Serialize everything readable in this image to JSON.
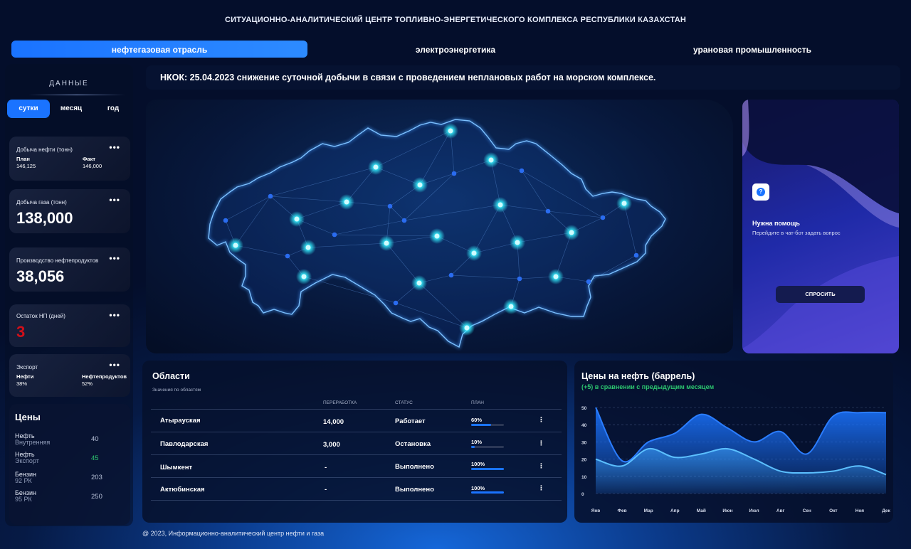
{
  "header": {
    "title": "СИТУАЦИОННО-АНАЛИТИЧЕСКИЙ ЦЕНТР ТОПЛИВНО-ЭНЕРГЕТИЧЕСКОГО КОМПЛЕКСА РЕСПУБЛИКИ КАЗАХСТАН"
  },
  "tabs": [
    {
      "label": "нефтегазовая отрасль",
      "active": true
    },
    {
      "label": "электроэнергетика",
      "active": false
    },
    {
      "label": "урановая промышленность",
      "active": false
    }
  ],
  "sidebar": {
    "heading": "ДАННЫЕ",
    "periods": [
      {
        "label": "сутки",
        "active": true
      },
      {
        "label": "месяц",
        "active": false
      },
      {
        "label": "год",
        "active": false
      }
    ],
    "cards": {
      "oil": {
        "label": "Добыча нефти (тонн)",
        "plan_label": "План",
        "plan_value": "146,125",
        "fact_label": "Факт",
        "fact_value": "146,000"
      },
      "gas": {
        "label": "Добыча газа (тонн)",
        "value": "138,000"
      },
      "products": {
        "label": "Производство нефтепродуктов",
        "value": "38,056"
      },
      "stock": {
        "label": "Остаток НП (дней)",
        "value": "3",
        "color": "#d0101a"
      },
      "export": {
        "label": "Экспорт",
        "oil_label": "Нефти",
        "oil_value": "38%",
        "prod_label": "Нефтепродуктов",
        "prod_value": "52%"
      }
    },
    "prices": {
      "heading": "Цены",
      "items": [
        {
          "name": "Нефть",
          "sub": "Внутренняя",
          "value": "40"
        },
        {
          "name": "Нефть",
          "sub": "Экспорт",
          "value": "45",
          "color": "#2cc56f"
        },
        {
          "name": "Бензин",
          "sub": "92 РК",
          "value": "203"
        },
        {
          "name": "Бензин",
          "sub": "95 РК",
          "value": "250"
        }
      ]
    }
  },
  "news": "НКОК: 25.04.2023 снижение суточной добычи в связи с проведением неплановых работ на морском комплексе.",
  "help": {
    "title": "Нужна помощь",
    "subtitle": "Перейдите в чат-бот задать вопрос",
    "button": "СПРОСИТЬ",
    "icon": "question-icon"
  },
  "regions": {
    "title": "Области",
    "subtitle": "Значения по областям",
    "columns": [
      "ПЕРЕРАБОТКА",
      "СТАТУС",
      "ПЛАН"
    ],
    "rows": [
      {
        "name": "Атырауская",
        "processing": "14,000",
        "status": "Работает",
        "plan": "60%",
        "plan_fraction": 0.6
      },
      {
        "name": "Павлодарская",
        "processing": "3,000",
        "status": "Остановка",
        "plan": "10%",
        "plan_fraction": 0.1
      },
      {
        "name": "Шымкент",
        "processing": "-",
        "status": "Выполнено",
        "plan": "100%",
        "plan_fraction": 1.0
      },
      {
        "name": "Актюбинская",
        "processing": "-",
        "status": "Выполнено",
        "plan": "100%",
        "plan_fraction": 1.0
      }
    ]
  },
  "chart_data": {
    "type": "area",
    "title": "Цены на нефть (баррель)",
    "subtitle": "(+5) в сравнении с предыдущим месяцем",
    "categories": [
      "Янв",
      "Фев",
      "Мар",
      "Апр",
      "Май",
      "Июн",
      "Июл",
      "Авг",
      "Сен",
      "Окт",
      "Ноя",
      "Дек"
    ],
    "y_tick_labels": [
      "50",
      "40",
      "30",
      "20",
      "10",
      "0"
    ],
    "ylim": [
      0,
      50
    ],
    "grid": true,
    "series": [
      {
        "values": [
          50,
          19,
          30,
          35,
          46,
          38,
          30,
          36,
          23,
          45,
          47,
          47
        ],
        "color": "#1a73ff"
      },
      {
        "values": [
          20,
          16,
          26,
          21,
          23,
          26,
          20,
          13,
          12,
          13,
          16,
          11
        ],
        "color": "#3fa6ff"
      }
    ]
  },
  "footer": "@ 2023, Информационно-аналитический центр нефти и газа"
}
